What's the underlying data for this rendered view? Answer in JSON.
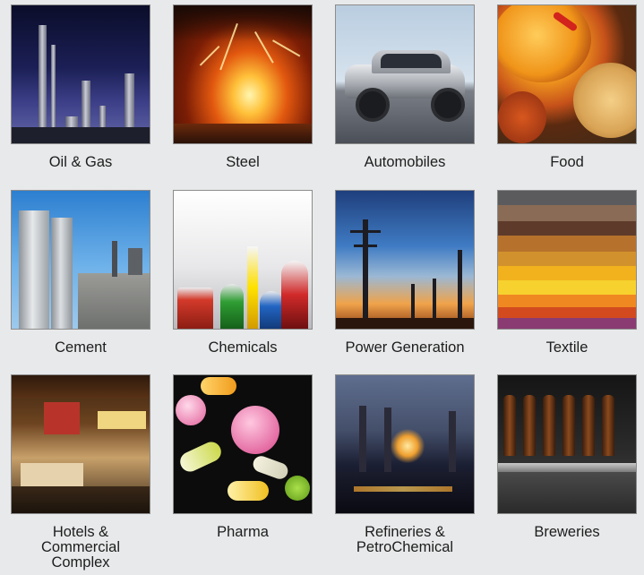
{
  "industries": [
    {
      "label": "Oil & Gas",
      "image_icon": "oil-gas-refinery-image"
    },
    {
      "label": "Steel",
      "image_icon": "molten-steel-image"
    },
    {
      "label": "Automobiles",
      "image_icon": "car-image"
    },
    {
      "label": "Food",
      "image_icon": "food-curry-image"
    },
    {
      "label": "Cement",
      "image_icon": "cement-plant-image"
    },
    {
      "label": "Chemicals",
      "image_icon": "lab-flasks-image"
    },
    {
      "label": "Power Generation",
      "image_icon": "power-tower-image"
    },
    {
      "label": "Textile",
      "image_icon": "fabric-layers-image"
    },
    {
      "label": "Hotels &\nCommercial\nComplex",
      "image_icon": "hotel-lobby-image"
    },
    {
      "label": "Pharma",
      "image_icon": "pills-image"
    },
    {
      "label": "Refineries &\nPetroChemical",
      "image_icon": "night-refinery-image"
    },
    {
      "label": "Breweries",
      "image_icon": "beer-bottles-image"
    }
  ],
  "colors": {
    "background": "#e8e9ea",
    "caption_text": "#1d1d1d",
    "image_border": "#8c8c8c"
  }
}
